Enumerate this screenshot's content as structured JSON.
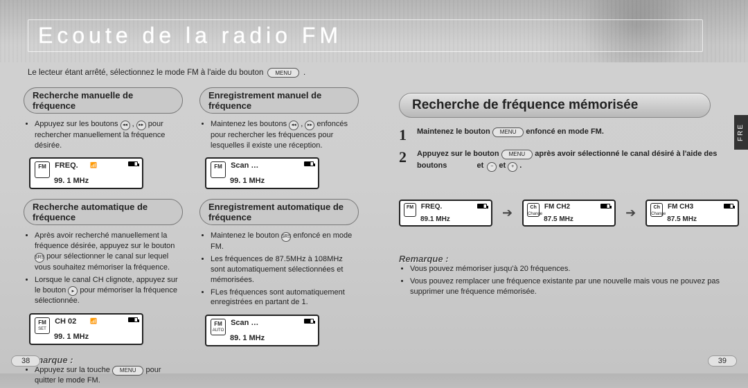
{
  "header": {
    "title": "Ecoute de la radio FM",
    "side_tab": "FRE"
  },
  "intro": {
    "text_before": "Le lecteur étant arrêté, sélectionnez le mode FM à l'aide du bouton",
    "menu_button": "MENU",
    "text_after": "."
  },
  "left_col": {
    "sec1": {
      "heading": "Recherche manuelle de fréquence",
      "bullet1_a": "Appuyez sur les boutons",
      "bullet1_b": ",",
      "bullet1_c": "pour rechercher manuellement la fréquence désirée.",
      "lcd": {
        "chip": "FM",
        "sub": "",
        "line1": "FREQ.",
        "line2": "99. 1   MHz"
      }
    },
    "sec2": {
      "heading": "Recherche automatique de fréquence",
      "bullet1_a": "Après avoir recherché manuellement la fréquence désirée, appuyez sur le bouton",
      "bullet1_b": "pour sélectionner le canal sur lequel vous souhaitez mémoriser la fréquence.",
      "bullet2_a": "Lorsque le canal CH clignote, appuyez sur le bouton",
      "bullet2_b": "pour mémoriser la fréquence sélectionnée.",
      "lcd": {
        "chip": "FM",
        "sub": "SET",
        "line1": "CH 02",
        "line2": "99. 1   MHz"
      }
    },
    "remarque_label": "Remarque :",
    "remarque_a": "Appuyez sur la touche",
    "remarque_btn": "MENU",
    "remarque_b": "pour quitter le mode FM."
  },
  "mid_col": {
    "sec1": {
      "heading": "Enregistrement manuel de fréquence",
      "bullet1_a": "Maintenez les boutons",
      "bullet1_b": ",",
      "bullet1_c": "enfoncés pour rechercher les fréquences pour lesquelles il existe une réception.",
      "lcd": {
        "chip": "FM",
        "sub": "",
        "line1": "Scan …",
        "line2": "99. 1   MHz"
      }
    },
    "sec2": {
      "heading": "Enregistrement automatique de fréquence",
      "bullet1_a": "Maintenez le bouton",
      "bullet1_b": "enfoncé en mode FM.",
      "bullet2": "Les fréquences de 87.5MHz à 108MHz sont automatiquement sélectionnées et mémorisées.",
      "bullet3": "FLes fréquences sont automatiquement enregistrées en partant de 1.",
      "lcd": {
        "chip": "FM",
        "sub": "AUTO",
        "line1": "Scan …",
        "line2": "89. 1   MHz"
      }
    }
  },
  "right": {
    "heading": "Recherche de fréquence mémorisée",
    "step1_num": "1",
    "step1_a": "Maintenez le bouton",
    "step1_btn": "MENU",
    "step1_b": "enfoncé en mode FM.",
    "step2_num": "2",
    "step2_a": "Appuyez sur le bouton",
    "step2_btn": "MENU",
    "step2_b": "après avoir sélectionné le canal désiré à l'aide des boutons",
    "step2_c": "et",
    "step2_d": ".",
    "lcd1": {
      "chip": "FM",
      "sub": "",
      "line1": "FREQ.",
      "line2": "89.1   MHz"
    },
    "lcd2": {
      "chip": "Ch",
      "sub": "Change",
      "line1": "FM CH2",
      "line2": "87.5   MHz"
    },
    "lcd3": {
      "chip": "Ch",
      "sub": "Change",
      "line1": "FM CH3",
      "line2": "87.5   MHz"
    },
    "remarque_label": "Remarque :",
    "bullet1": "Vous pouvez mémoriser jusqu'à 20 fréquences.",
    "bullet2": "Vous pouvez remplacer une fréquence existante par une nouvelle mais vous ne pouvez pas supprimer une fréquence mémorisée."
  },
  "pages": {
    "left": "38",
    "right": "39"
  }
}
